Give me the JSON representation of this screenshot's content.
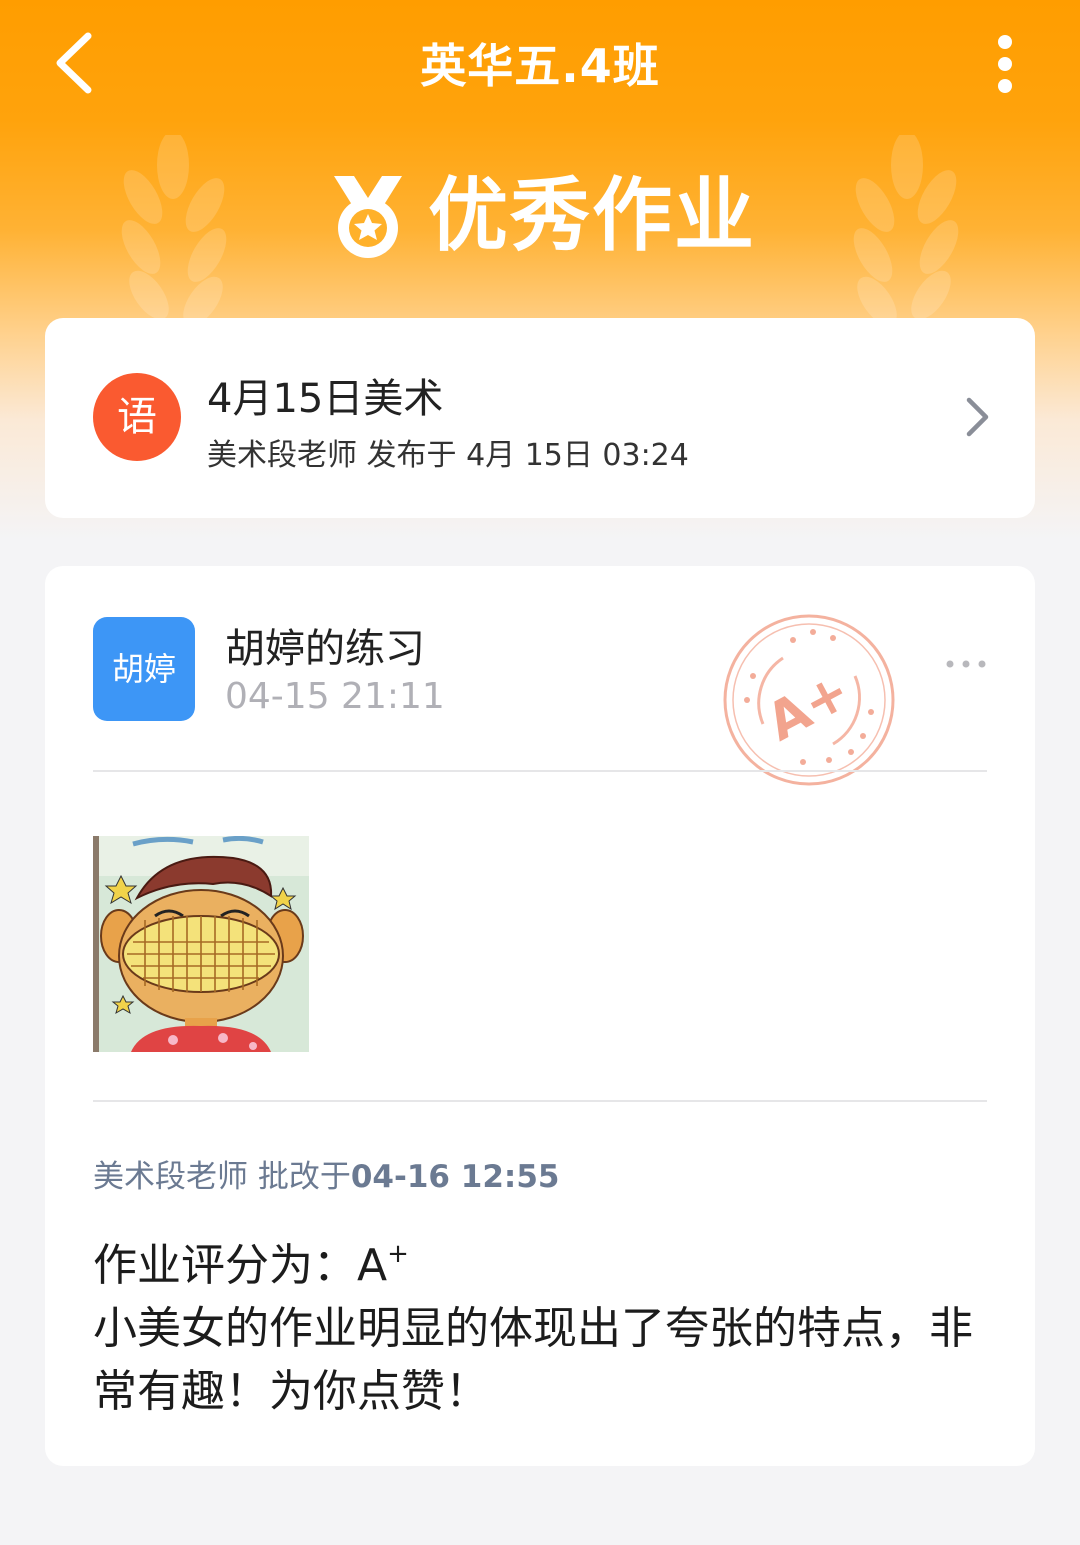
{
  "header": {
    "title": "英华五.4班",
    "banner_text": "优秀作业"
  },
  "assignment": {
    "subject_badge": "语",
    "title": "4月15日美术",
    "meta": "美术段老师 发布于 4月 15日 03:24"
  },
  "work": {
    "avatar_text": "胡婷",
    "title": "胡婷的练习",
    "submitted_at": "04-15 21:11",
    "stamp_grade": "A+",
    "grader_prefix": "美术段老师 批改于",
    "graded_at": "04-16 12:55",
    "score_label": "作业评分为：",
    "score_letter": "A",
    "score_sup": "+",
    "comment": "小美女的作业明显的体现出了夸张的特点，非常有趣！为你点赞！"
  },
  "colors": {
    "header_orange": "#ff9d00",
    "subject_badge": "#fa5a30",
    "avatar_blue": "#3d96f6",
    "stamp": "#f2a48e",
    "grader_text": "#6b7a92"
  },
  "icons": [
    "back-arrow-icon",
    "more-vertical-icon",
    "medal-icon",
    "wheat-left-icon",
    "wheat-right-icon",
    "chevron-right-icon",
    "more-horizontal-icon",
    "grade-stamp-icon"
  ]
}
